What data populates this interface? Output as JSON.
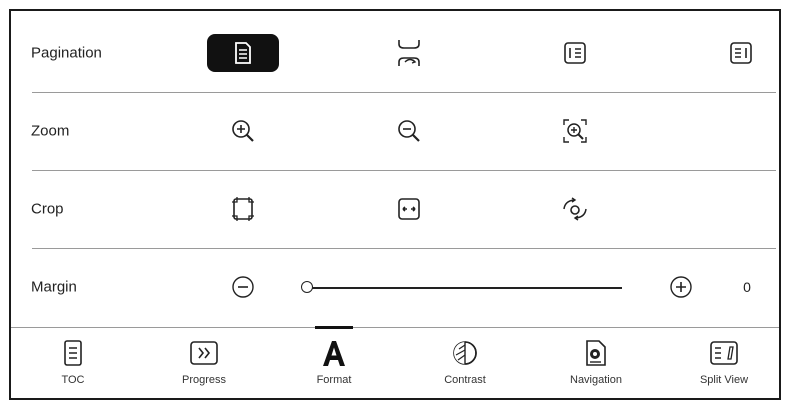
{
  "rows": [
    {
      "label": "Pagination",
      "icons": [
        "page-single-icon",
        "page-turn-icon",
        "page-number-left-icon",
        "page-number-right-icon"
      ],
      "selected": "page-single-icon"
    },
    {
      "label": "Zoom",
      "icons": [
        "zoom-in-icon",
        "zoom-out-icon",
        "zoom-fit-icon"
      ]
    },
    {
      "label": "Crop",
      "icons": [
        "crop-auto-icon",
        "crop-width-icon",
        "crop-rotate-icon"
      ]
    },
    {
      "label": "Margin",
      "icons": [
        "margin-decrease-icon",
        "margin-increase-icon"
      ],
      "value": "0",
      "slider_value": 0
    }
  ],
  "tabs": [
    {
      "label": "TOC",
      "icon": "toc-icon"
    },
    {
      "label": "Progress",
      "icon": "progress-icon"
    },
    {
      "label": "Format",
      "icon": "format-icon",
      "active": true
    },
    {
      "label": "Contrast",
      "icon": "contrast-icon"
    },
    {
      "label": "Navigation",
      "icon": "navigation-icon"
    },
    {
      "label": "Split View",
      "icon": "split-view-icon"
    }
  ],
  "colors": {
    "border": "#1a1a1a",
    "divider": "#9a9a9a",
    "selected_bg": "#111111",
    "text": "#222222"
  }
}
